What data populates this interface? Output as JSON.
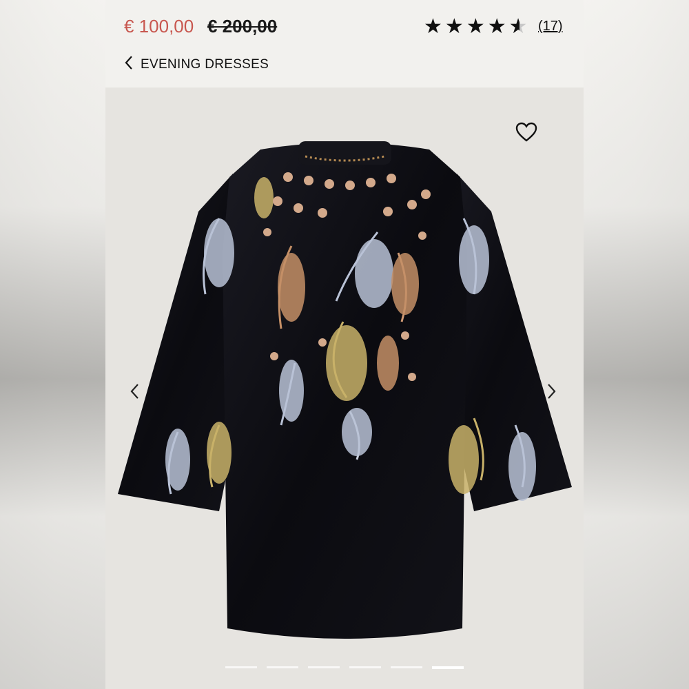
{
  "product": {
    "price": "€ 100,00",
    "old_price": "€ 200,00",
    "rating_stars": 4.5,
    "reviews": "(17)"
  },
  "nav": {
    "back_label": "EVENING DRESSES"
  },
  "gallery": {
    "slide_count": 6,
    "active_slide": 6
  },
  "icons": [
    "chevron-left-icon",
    "heart-icon",
    "chevron-right-icon"
  ],
  "colors": {
    "price": "#c8574f",
    "text": "#111111",
    "background": "#f2f1ee"
  }
}
